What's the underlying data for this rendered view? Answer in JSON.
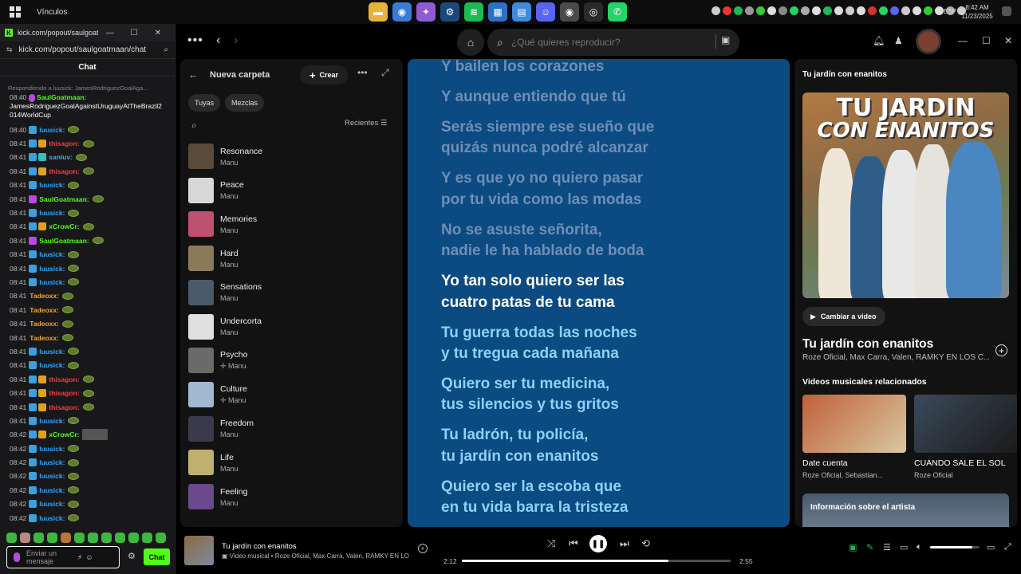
{
  "taskbar": {
    "window_title": "Vínculos",
    "language": "ESP",
    "time": "8:42 AM",
    "date": "11/23/2025",
    "apps": [
      {
        "icon": "file-explorer-icon",
        "color": "#e8b33a",
        "glyph": "▬"
      },
      {
        "icon": "chrome-icon",
        "color": "#3a7bd5",
        "glyph": "◉"
      },
      {
        "icon": "copilot-icon",
        "color": "#8f5bd4",
        "glyph": "✦"
      },
      {
        "icon": "steam-icon",
        "color": "#1b4a7a",
        "glyph": "⚙"
      },
      {
        "icon": "spotify-icon",
        "color": "#1db954",
        "glyph": "≋"
      },
      {
        "icon": "store-icon",
        "color": "#2d6fc2",
        "glyph": "▦"
      },
      {
        "icon": "files-icon",
        "color": "#3d8be0",
        "glyph": "▤"
      },
      {
        "icon": "discord-icon",
        "color": "#5865f2",
        "glyph": "☺"
      },
      {
        "icon": "chrome-profile-icon",
        "color": "#4a4a4a",
        "glyph": "◉"
      },
      {
        "icon": "obs-icon",
        "color": "#2a2a2a",
        "glyph": "◎"
      },
      {
        "icon": "whatsapp-icon",
        "color": "#25d366",
        "glyph": "✆"
      }
    ],
    "tray_colors": [
      "#ccc",
      "#e33",
      "#1db954",
      "#999",
      "#3c3",
      "#ddd",
      "#888",
      "#25d366",
      "#aaa",
      "#ddd",
      "#1db954",
      "#ddd",
      "#ccc",
      "#ddd",
      "#c33",
      "#25d366",
      "#5865f2",
      "#ccc",
      "#ddd",
      "#3c3",
      "#ddd",
      "#aaa",
      "#ccc"
    ]
  },
  "kick": {
    "tab_url": "kick.com/popout/saulgoatm...",
    "address": "kick.com/popout/saulgoatmaan/chat",
    "title": "Chat",
    "reply_note": "Respondiendo a luusick: JamesRodriguezGoalAga...",
    "first_msg_time": "08:40",
    "first_msg_user": "SaulGoatmaan:",
    "first_msg_text": "JamesRodriguezGoalAgainstUruguayAtTheBrazil2014WorldCup",
    "rows": [
      {
        "time": "08:40",
        "badges": [
          "#3aa0e0"
        ],
        "user": "luusick:",
        "color": "#2ea7ff",
        "emote": "pepe"
      },
      {
        "time": "08:41",
        "badges": [
          "#3aa0e0",
          "#e0a020"
        ],
        "user": "thisagon:",
        "color": "#ff3b3b",
        "emote": "pepe"
      },
      {
        "time": "08:41",
        "badges": [
          "#3aa0e0",
          "#35c0c0"
        ],
        "user": "sanluv:",
        "color": "#3da9ff",
        "emote": "pepe"
      },
      {
        "time": "08:41",
        "badges": [
          "#3aa0e0",
          "#e0a020"
        ],
        "user": "thisagon:",
        "color": "#ff3b3b",
        "emote": "pepe"
      },
      {
        "time": "08:41",
        "badges": [
          "#3aa0e0"
        ],
        "user": "luusick:",
        "color": "#2ea7ff",
        "emote": "pepe"
      },
      {
        "time": "08:41",
        "badges": [
          "#b74be0"
        ],
        "user": "SaulGoatmaan:",
        "color": "#53fc18",
        "emote": "pepe"
      },
      {
        "time": "08:41",
        "badges": [
          "#3aa0e0"
        ],
        "user": "luusick:",
        "color": "#2ea7ff",
        "emote": "pepe"
      },
      {
        "time": "08:41",
        "badges": [
          "#3aa0e0",
          "#e0a020"
        ],
        "user": "xCrowCr:",
        "color": "#53fc18",
        "emote": "pepe"
      },
      {
        "time": "08:41",
        "badges": [
          "#b74be0"
        ],
        "user": "SaulGoatmaan:",
        "color": "#53fc18",
        "emote": "pepe"
      },
      {
        "time": "08:41",
        "badges": [
          "#3aa0e0"
        ],
        "user": "luusick:",
        "color": "#2ea7ff",
        "emote": "pepe"
      },
      {
        "time": "08:41",
        "badges": [
          "#3aa0e0"
        ],
        "user": "luusick:",
        "color": "#2ea7ff",
        "emote": "pepe"
      },
      {
        "time": "08:41",
        "badges": [
          "#3aa0e0"
        ],
        "user": "luusick:",
        "color": "#2ea7ff",
        "emote": "pepe"
      },
      {
        "time": "08:41",
        "badges": [],
        "user": "Tadeoxx:",
        "color": "#f5a623",
        "emote": "pepe"
      },
      {
        "time": "08:41",
        "badges": [],
        "user": "Tadeoxx:",
        "color": "#f5a623",
        "emote": "pepe"
      },
      {
        "time": "08:41",
        "badges": [],
        "user": "Tadeoxx:",
        "color": "#f5a623",
        "emote": "pepe"
      },
      {
        "time": "08:41",
        "badges": [],
        "user": "Tadeoxx:",
        "color": "#f5a623",
        "emote": "pepe"
      },
      {
        "time": "08:41",
        "badges": [
          "#3aa0e0"
        ],
        "user": "luusick:",
        "color": "#2ea7ff",
        "emote": "pepe"
      },
      {
        "time": "08:41",
        "badges": [
          "#3aa0e0"
        ],
        "user": "luusick:",
        "color": "#2ea7ff",
        "emote": "pepe"
      },
      {
        "time": "08:41",
        "badges": [
          "#3aa0e0",
          "#e0a020"
        ],
        "user": "thisagon:",
        "color": "#ff3b3b",
        "emote": "pepe"
      },
      {
        "time": "08:41",
        "badges": [
          "#3aa0e0",
          "#e0a020"
        ],
        "user": "thisagon:",
        "color": "#ff3b3b",
        "emote": "pepe"
      },
      {
        "time": "08:41",
        "badges": [
          "#3aa0e0",
          "#e0a020"
        ],
        "user": "thisagon:",
        "color": "#ff3b3b",
        "emote": "pepe"
      },
      {
        "time": "08:41",
        "badges": [
          "#3aa0e0"
        ],
        "user": "luusick:",
        "color": "#2ea7ff",
        "emote": "pepe"
      },
      {
        "time": "08:42",
        "badges": [
          "#3aa0e0",
          "#e0a020"
        ],
        "user": "xCrowCr:",
        "color": "#53fc18",
        "emote": "image"
      },
      {
        "time": "08:42",
        "badges": [
          "#3aa0e0"
        ],
        "user": "luusick:",
        "color": "#2ea7ff",
        "emote": "pepe"
      },
      {
        "time": "08:42",
        "badges": [
          "#3aa0e0"
        ],
        "user": "luusick:",
        "color": "#2ea7ff",
        "emote": "pepe"
      },
      {
        "time": "08:42",
        "badges": [
          "#3aa0e0"
        ],
        "user": "luusick:",
        "color": "#2ea7ff",
        "emote": "pepe"
      },
      {
        "time": "08:42",
        "badges": [
          "#3aa0e0"
        ],
        "user": "luusick:",
        "color": "#2ea7ff",
        "emote": "pepe"
      },
      {
        "time": "08:42",
        "badges": [
          "#3aa0e0"
        ],
        "user": "luusick:",
        "color": "#2ea7ff",
        "emote": "pepe"
      },
      {
        "time": "08:42",
        "badges": [
          "#3aa0e0"
        ],
        "user": "luusick:",
        "color": "#2ea7ff",
        "emote": "pepe"
      }
    ],
    "input_placeholder": "Enviar un mensaje",
    "chat_button": "Chat",
    "accent": "#53fc18"
  },
  "spotify": {
    "search_placeholder": "¿Qué quieres reproducir?",
    "library": {
      "title": "Nueva carpeta",
      "create": "Crear",
      "chips": [
        "Tuyas",
        "Mezclas"
      ],
      "sort": "Recientes",
      "playlists": [
        {
          "name": "Resonance",
          "sub": "Manu",
          "color": "#5a4a3a"
        },
        {
          "name": "Peace",
          "sub": "Manu",
          "color": "#d8d8d8"
        },
        {
          "name": "Memories",
          "sub": "Manu",
          "color": "#c05070"
        },
        {
          "name": "Hard",
          "sub": "Manu",
          "color": "#8a7a5a"
        },
        {
          "name": "Sensations",
          "sub": "Manu",
          "color": "#4a5a6a"
        },
        {
          "name": "Undercorta",
          "sub": "Manu",
          "color": "#e0e0e0"
        },
        {
          "name": "Psycho",
          "sub": "✛ Manu",
          "color": "#6a6a6a"
        },
        {
          "name": "Culture",
          "sub": "✛ Manu",
          "color": "#a0b8d0"
        },
        {
          "name": "Freedom",
          "sub": "Manu",
          "color": "#3a3a4a"
        },
        {
          "name": "Life",
          "sub": "Manu",
          "color": "#c0b070"
        },
        {
          "name": "Feeling",
          "sub": "Manu",
          "color": "#6a4a8a"
        }
      ]
    },
    "lyrics": [
      {
        "text": "Y bailen los corazones",
        "state": "past"
      },
      {
        "text": "Y aunque entiendo que tú",
        "state": "past"
      },
      {
        "text": "Serás siempre ese sueño que",
        "state": "past"
      },
      {
        "text": "quizás nunca podré alcanzar",
        "state": "past"
      },
      {
        "text": "Y es que yo no quiero pasar",
        "state": "past"
      },
      {
        "text": "por tu vida como las modas",
        "state": "past"
      },
      {
        "text": "No se asuste señorita,",
        "state": "past"
      },
      {
        "text": "nadie le ha hablado de boda",
        "state": "past"
      },
      {
        "text": "Yo tan solo quiero ser las",
        "state": "current"
      },
      {
        "text": "cuatro patas de tu cama",
        "state": "current"
      },
      {
        "text": "Tu guerra todas las noches",
        "state": "future"
      },
      {
        "text": "y tu tregua cada mañana",
        "state": "future"
      },
      {
        "text": "Quiero ser tu medicina,",
        "state": "future"
      },
      {
        "text": "tus silencios y tus gritos",
        "state": "future"
      },
      {
        "text": "Tu ladrón, tu policía,",
        "state": "future"
      },
      {
        "text": "tu jardín con enanitos",
        "state": "future"
      },
      {
        "text": "Quiero ser la escoba que",
        "state": "future"
      },
      {
        "text": "en tu vida barra la tristeza",
        "state": "future"
      }
    ],
    "lyric_colors": {
      "past": "#6f8fb6",
      "current": "#ffffff",
      "future": "#8fd0f7"
    },
    "now_playing": {
      "header": "Tu jardín con enanitos",
      "cover_title_1": "TU JARDIN",
      "cover_title_2": "CON ENANITOS",
      "video_button": "Cambiar a video",
      "song": "Tu jardín con enanitos",
      "artists": "Roze Oficial, Max Carra, Valen, RAMKY EN LOS C...",
      "related_title": "Videos musicales relacionados",
      "related": [
        {
          "title": "Date cuenta",
          "sub": "Roze Oficial, Sebastian...",
          "color": "#c0603a"
        },
        {
          "title": "CUANDO SALE EL SOL",
          "sub": "Roze Oficial",
          "color": "#3a4a5a"
        }
      ],
      "artist_info": "Información sobre el artista"
    },
    "player": {
      "title": "Tu jardín con enanitos",
      "subtitle": "Video musical • Roze Oficial, Max Carra, Valen, RAMKY EN LOS C...",
      "elapsed": "2:12",
      "duration": "2:55",
      "progress": 0.77,
      "volume": 0.85
    }
  }
}
